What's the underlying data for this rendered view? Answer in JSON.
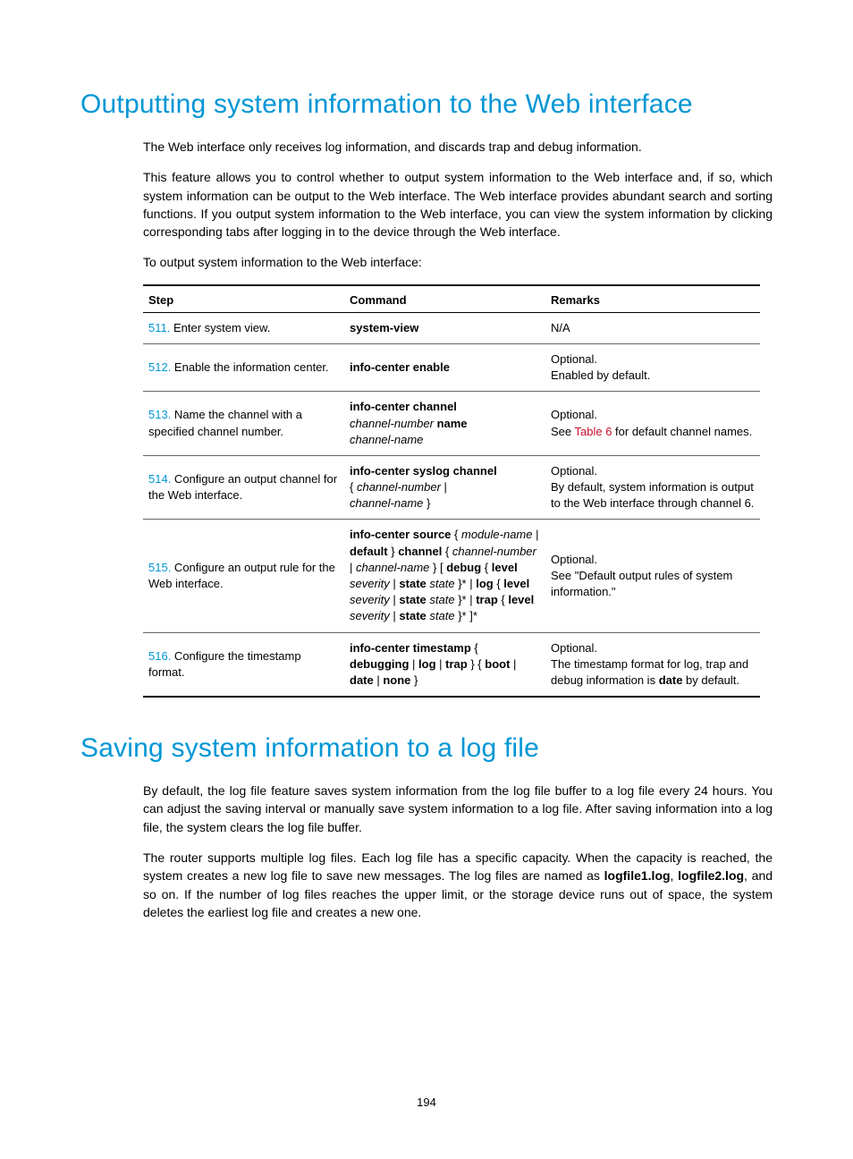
{
  "page_number": "194",
  "section1": {
    "title": "Outputting system information to the Web interface",
    "para1": "The Web interface only receives log information, and discards trap and debug information.",
    "para2": "This feature allows you to control whether to output system information to the Web interface and, if so, which system information can be output to the Web interface. The Web interface provides abundant search and sorting functions. If you output system information to the Web interface, you can view the system information by clicking corresponding tabs after logging in to the device through the Web interface.",
    "para3": "To output system information to the Web interface:"
  },
  "table1": {
    "headers": {
      "step": "Step",
      "command": "Command",
      "remarks": "Remarks"
    },
    "rows": [
      {
        "num": "511.",
        "step": "Enter system view.",
        "command_segments": [
          {
            "t": "system-view",
            "b": true
          }
        ],
        "remarks_segments": [
          {
            "t": "N/A"
          }
        ]
      },
      {
        "num": "512.",
        "step": "Enable the information center.",
        "command_segments": [
          {
            "t": "info-center enable",
            "b": true
          }
        ],
        "remarks_segments": [
          {
            "t": "Optional."
          },
          {
            "br": true
          },
          {
            "t": "Enabled by default."
          }
        ]
      },
      {
        "num": "513.",
        "step": "Name the channel with a specified channel number.",
        "command_segments": [
          {
            "t": "info-center channel",
            "b": true
          },
          {
            "br": true
          },
          {
            "t": "channel-number",
            "i": true
          },
          {
            "t": " "
          },
          {
            "t": "name",
            "b": true
          },
          {
            "br": true
          },
          {
            "t": "channel-name",
            "i": true
          }
        ],
        "remarks_segments": [
          {
            "t": "Optional."
          },
          {
            "br": true
          },
          {
            "t": "See "
          },
          {
            "t": "Table 6",
            "link": true
          },
          {
            "t": " for default channel names."
          }
        ]
      },
      {
        "num": "514.",
        "step": "Configure an output channel for the Web interface.",
        "command_segments": [
          {
            "t": "info-center syslog channel",
            "b": true
          },
          {
            "br": true
          },
          {
            "t": "{ "
          },
          {
            "t": "channel-number",
            "i": true
          },
          {
            "t": " |"
          },
          {
            "br": true
          },
          {
            "t": "channel-name",
            "i": true
          },
          {
            "t": " }"
          }
        ],
        "remarks_segments": [
          {
            "t": "Optional."
          },
          {
            "br": true
          },
          {
            "t": "By default, system information is output to the Web interface through channel 6."
          }
        ]
      },
      {
        "num": "515.",
        "step": "Configure an output rule for the Web interface.",
        "command_segments": [
          {
            "t": "info-center source",
            "b": true
          },
          {
            "t": " { "
          },
          {
            "t": "module-name",
            "i": true
          },
          {
            "t": " | "
          },
          {
            "t": "default",
            "b": true
          },
          {
            "t": " } "
          },
          {
            "t": "channel",
            "b": true
          },
          {
            "t": " { "
          },
          {
            "t": "channel-number",
            "i": true
          },
          {
            "t": " | "
          },
          {
            "t": "channel-name",
            "i": true
          },
          {
            "t": " } [ "
          },
          {
            "t": "debug",
            "b": true
          },
          {
            "t": " { "
          },
          {
            "t": "level",
            "b": true
          },
          {
            "t": " "
          },
          {
            "t": "severity",
            "i": true
          },
          {
            "t": " | "
          },
          {
            "t": "state",
            "b": true
          },
          {
            "t": " "
          },
          {
            "t": "state",
            "i": true
          },
          {
            "t": " }* | "
          },
          {
            "t": "log",
            "b": true
          },
          {
            "t": " { "
          },
          {
            "t": "level",
            "b": true
          },
          {
            "t": " "
          },
          {
            "t": "severity",
            "i": true
          },
          {
            "t": " | "
          },
          {
            "t": "state",
            "b": true
          },
          {
            "t": " "
          },
          {
            "t": "state",
            "i": true
          },
          {
            "t": " }* | "
          },
          {
            "t": "trap",
            "b": true
          },
          {
            "t": " { "
          },
          {
            "t": "level",
            "b": true
          },
          {
            "t": " "
          },
          {
            "t": "severity",
            "i": true
          },
          {
            "t": " | "
          },
          {
            "t": "state",
            "b": true
          },
          {
            "t": " "
          },
          {
            "t": "state",
            "i": true
          },
          {
            "t": " }* ]*"
          }
        ],
        "remarks_segments": [
          {
            "t": "Optional."
          },
          {
            "br": true
          },
          {
            "t": "See \"Default output rules of system information.\""
          }
        ]
      },
      {
        "num": "516.",
        "step": "Configure the timestamp format.",
        "command_segments": [
          {
            "t": "info-center timestamp",
            "b": true
          },
          {
            "t": " { "
          },
          {
            "t": "debugging",
            "b": true
          },
          {
            "t": " | "
          },
          {
            "t": "log",
            "b": true
          },
          {
            "t": " | "
          },
          {
            "t": "trap",
            "b": true
          },
          {
            "t": " } { "
          },
          {
            "t": "boot",
            "b": true
          },
          {
            "t": " | "
          },
          {
            "t": "date",
            "b": true
          },
          {
            "t": " | "
          },
          {
            "t": "none",
            "b": true
          },
          {
            "t": " }"
          }
        ],
        "remarks_segments": [
          {
            "t": "Optional."
          },
          {
            "br": true
          },
          {
            "t": "The timestamp format for log, trap and debug information is "
          },
          {
            "t": "date",
            "b": true
          },
          {
            "t": " by default."
          }
        ]
      }
    ]
  },
  "section2": {
    "title": "Saving system information to a log file",
    "para1": "By default, the log file feature saves system information from the log file buffer to a log file every 24 hours. You can adjust the saving interval or manually save system information to a log file. After saving information into a log file, the system clears the log file buffer.",
    "para2_segments": [
      {
        "t": "The router supports multiple log files. Each log file has a specific capacity. When the capacity is reached, the system creates a new log file to save new messages. The log files are named as "
      },
      {
        "t": "logfile1.log",
        "b": true
      },
      {
        "t": ", "
      },
      {
        "t": "logfile2.log",
        "b": true
      },
      {
        "t": ", and so on. If the number of log files reaches the upper limit, or the storage device runs out of space, the system deletes the earliest log file and creates a new one."
      }
    ]
  }
}
